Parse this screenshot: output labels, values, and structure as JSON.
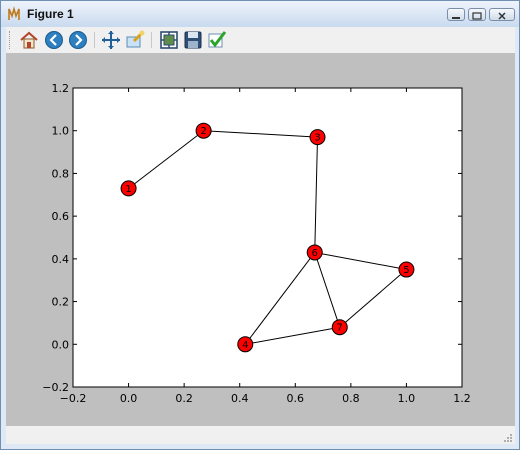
{
  "window": {
    "title": "Figure 1"
  },
  "toolbar": {
    "buttons": [
      {
        "name": "home",
        "icon": "home-icon"
      },
      {
        "name": "back",
        "icon": "back-arrow-icon"
      },
      {
        "name": "forward",
        "icon": "forward-arrow-icon"
      },
      {
        "name": "pan",
        "icon": "move-arrows-icon"
      },
      {
        "name": "zoom",
        "icon": "zoom-rectangle-icon"
      },
      {
        "name": "configure-subplots",
        "icon": "subplots-icon"
      },
      {
        "name": "save",
        "icon": "floppy-disk-icon"
      },
      {
        "name": "edit-parameters",
        "icon": "checkmark-icon"
      }
    ]
  },
  "colors": {
    "node_fill": "#ff0000",
    "edge": "#000000",
    "figure_bg": "#bfbfbf",
    "axes_bg": "#ffffff"
  },
  "chart_data": {
    "type": "scatter",
    "title": "",
    "xlabel": "",
    "ylabel": "",
    "xlim": [
      -0.2,
      1.2
    ],
    "ylim": [
      -0.2,
      1.2
    ],
    "xticks": [
      "−0.2",
      "0.0",
      "0.2",
      "0.4",
      "0.6",
      "0.8",
      "1.0",
      "1.2"
    ],
    "yticks": [
      "−0.2",
      "0.0",
      "0.2",
      "0.4",
      "0.6",
      "0.8",
      "1.0",
      "1.2"
    ],
    "grid": false,
    "nodes": [
      {
        "label": "1",
        "x": 0.0,
        "y": 0.73
      },
      {
        "label": "2",
        "x": 0.27,
        "y": 1.0
      },
      {
        "label": "3",
        "x": 0.68,
        "y": 0.97
      },
      {
        "label": "4",
        "x": 0.42,
        "y": 0.0
      },
      {
        "label": "5",
        "x": 1.0,
        "y": 0.35
      },
      {
        "label": "6",
        "x": 0.67,
        "y": 0.43
      },
      {
        "label": "7",
        "x": 0.76,
        "y": 0.08
      }
    ],
    "edges": [
      [
        "1",
        "2"
      ],
      [
        "2",
        "3"
      ],
      [
        "3",
        "6"
      ],
      [
        "6",
        "5"
      ],
      [
        "6",
        "4"
      ],
      [
        "6",
        "7"
      ],
      [
        "4",
        "7"
      ],
      [
        "7",
        "5"
      ]
    ]
  }
}
